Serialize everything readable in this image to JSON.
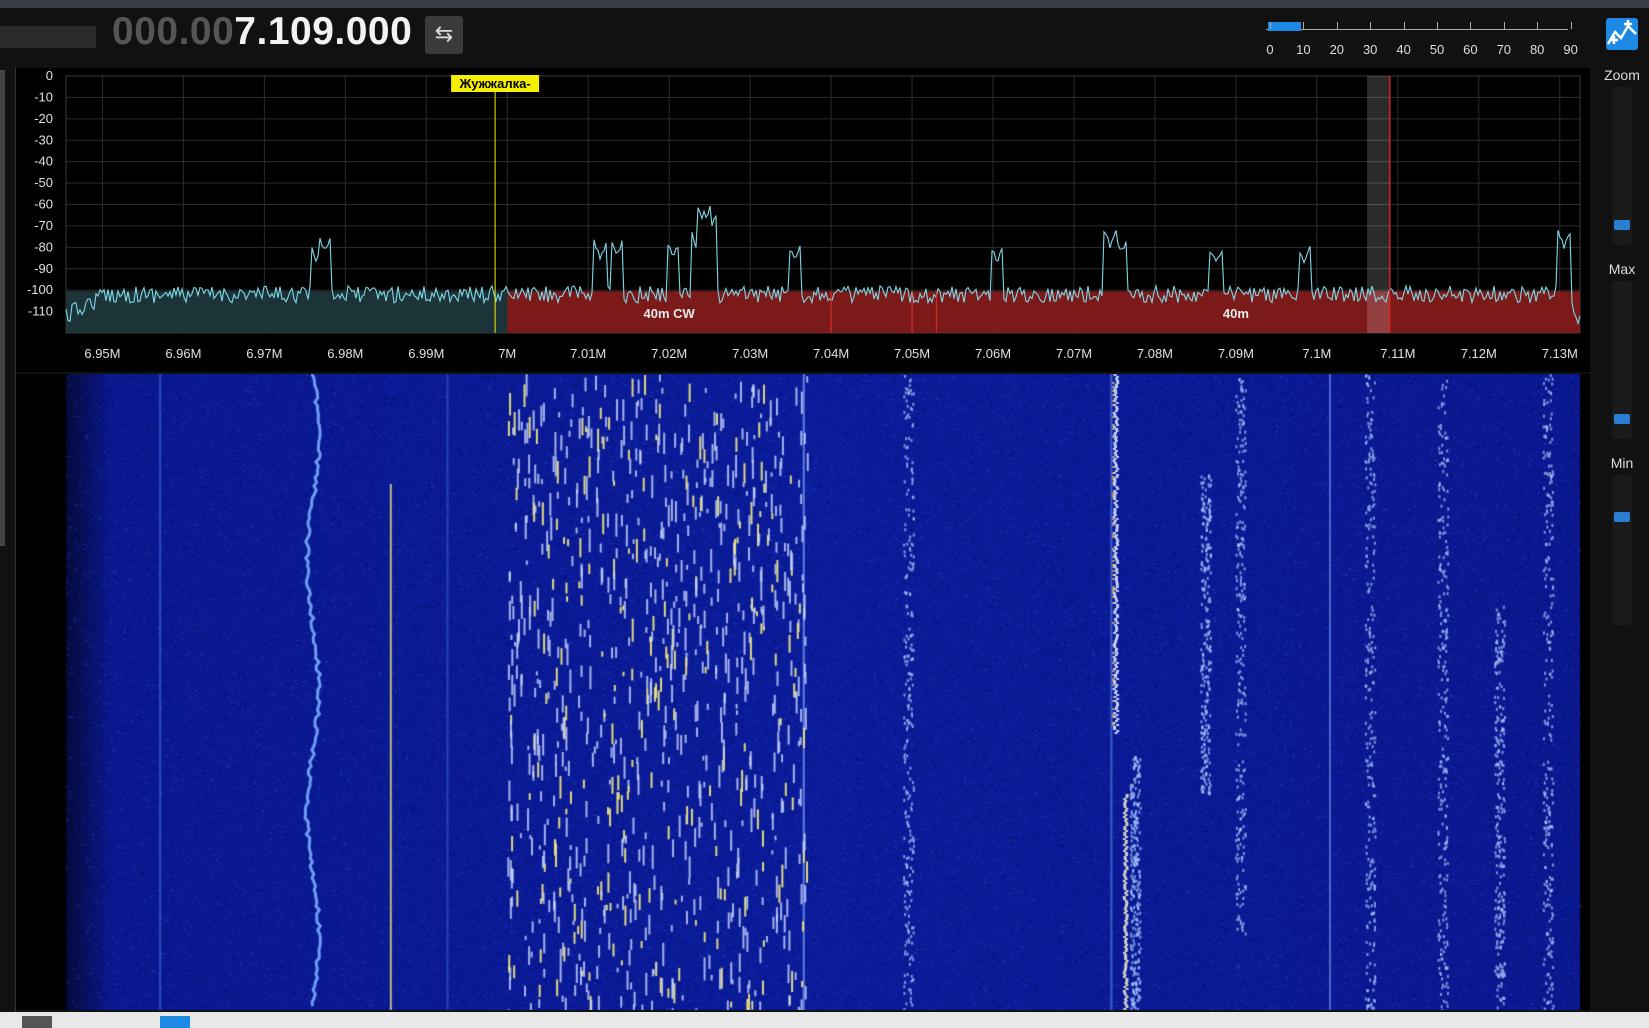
{
  "frequency": {
    "dim_part": "000.00",
    "bright_part": "7.109.000",
    "swap_icon": "swap-arrows-icon"
  },
  "smeter": {
    "ticks": [
      "0",
      "10",
      "20",
      "30",
      "40",
      "50",
      "60",
      "70",
      "80",
      "90"
    ],
    "level_fraction": 0.11,
    "bar_color": "#1e88e5"
  },
  "side_controls": {
    "zoom_label": "Zoom",
    "max_label": "Max",
    "min_label": "Min",
    "zoom_level": 0.15,
    "max_level": 0.15,
    "min_level": 0.75
  },
  "spectrum": {
    "marker_label": "Жужжалка-",
    "y_ticks": [
      "0",
      "-10",
      "-20",
      "-30",
      "-40",
      "-50",
      "-60",
      "-70",
      "-80",
      "-90",
      "-100",
      "-110"
    ],
    "x_ticks": [
      "6.95M",
      "6.96M",
      "6.97M",
      "6.98M",
      "6.99M",
      "7M",
      "7.01M",
      "7.02M",
      "7.03M",
      "7.04M",
      "7.05M",
      "7.06M",
      "7.07M",
      "7.08M",
      "7.09M",
      "7.1M",
      "7.11M",
      "7.12M",
      "7.13M"
    ],
    "band_cw_label": "40m CW",
    "band_40m_label": "40m",
    "colors": {
      "trace": "#7fd8e6",
      "band": "#8a1c1c",
      "marker": "#f5f000",
      "vfo": "#e02020",
      "noise_fill": "#1f3a3e"
    }
  },
  "waterfall": {
    "colors": {
      "background": "#04042a",
      "signal": "#3d6fe0",
      "strong": "#e8e080"
    }
  }
}
